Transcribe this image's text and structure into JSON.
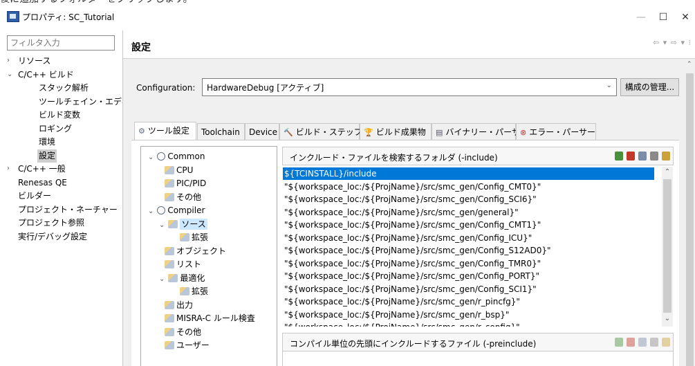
{
  "caption": "後に追加するフォルダーをクリックします。",
  "window": {
    "title": "プロパティ: SC_Tutorial",
    "controls": [
      "—",
      "☐",
      "✕"
    ]
  },
  "filter": {
    "placeholder": "フィルタ入力"
  },
  "nav": [
    {
      "label": "リソース",
      "expander": "›"
    },
    {
      "label": "C/C++ ビルド",
      "expander": "⌄"
    },
    {
      "label": "スタック解析"
    },
    {
      "label": "ツールチェイン・エディタ"
    },
    {
      "label": "ビルド変数"
    },
    {
      "label": "ロギング"
    },
    {
      "label": "環境"
    },
    {
      "label": "設定",
      "selected": true
    },
    {
      "label": "C/C++ 一般",
      "expander": "›"
    },
    {
      "label": "Renesas QE"
    },
    {
      "label": "ビルダー"
    },
    {
      "label": "プロジェクト・ネーチャー"
    },
    {
      "label": "プロジェクト参照"
    },
    {
      "label": "実行/デバッグ設定"
    }
  ],
  "header": {
    "title": "設定",
    "nav_glyphs": "⇦ ▾ ⇨ ▾ ⁝"
  },
  "config": {
    "label": "Configuration:",
    "value": "HardwareDebug [アクティブ]",
    "manage_button": "構成の管理..."
  },
  "tabs": [
    {
      "label": "ツール設定",
      "icon": "gear-icon",
      "active": true
    },
    {
      "label": "Toolchain"
    },
    {
      "label": "Device"
    },
    {
      "label": "ビルド・ステップ",
      "icon": "hammer-icon"
    },
    {
      "label": "ビルド成果物",
      "icon": "trophy-icon"
    },
    {
      "label": "バイナリー・パーサー",
      "icon": "binary-icon"
    },
    {
      "label": "エラー・パーサー",
      "icon": "error-icon"
    }
  ],
  "tree": [
    {
      "label": "Common",
      "expander": "⌄",
      "icon": "gear-icon"
    },
    {
      "label": "CPU",
      "icon": "tool-icon"
    },
    {
      "label": "PIC/PID",
      "icon": "tool-icon"
    },
    {
      "label": "その他",
      "icon": "tool-icon"
    },
    {
      "label": "Compiler",
      "expander": "⌄",
      "icon": "gear-icon"
    },
    {
      "label": "ソース",
      "expander": "⌄",
      "icon": "tool-icon",
      "selected": true
    },
    {
      "label": "拡張",
      "icon": "tool-icon"
    },
    {
      "label": "オブジェクト",
      "icon": "tool-icon"
    },
    {
      "label": "リスト",
      "icon": "tool-icon"
    },
    {
      "label": "最適化",
      "expander": "⌄",
      "icon": "tool-icon"
    },
    {
      "label": "拡張",
      "icon": "tool-icon"
    },
    {
      "label": "出力",
      "icon": "tool-icon"
    },
    {
      "label": "MISRA-C ルール検査",
      "icon": "tool-icon"
    },
    {
      "label": "その他",
      "icon": "tool-icon"
    },
    {
      "label": "ユーザー",
      "icon": "tool-icon"
    }
  ],
  "include_panel": {
    "title": "インクルード・ファイルを検索するフォルダ (-include)",
    "tool_icons": [
      "add-icon",
      "delete-icon",
      "edit-icon",
      "move-up-icon",
      "move-down-icon"
    ],
    "items": [
      "${TCINSTALL}/include",
      "\"${workspace_loc:/${ProjName}/src/smc_gen/Config_CMT0}\"",
      "\"${workspace_loc:/${ProjName}/src/smc_gen/Config_SCI6}\"",
      "\"${workspace_loc:/${ProjName}/src/smc_gen/general}\"",
      "\"${workspace_loc:/${ProjName}/src/smc_gen/Config_CMT1}\"",
      "\"${workspace_loc:/${ProjName}/src/smc_gen/Config_ICU}\"",
      "\"${workspace_loc:/${ProjName}/src/smc_gen/Config_S12AD0}\"",
      "\"${workspace_loc:/${ProjName}/src/smc_gen/Config_TMR0}\"",
      "\"${workspace_loc:/${ProjName}/src/smc_gen/Config_PORT}\"",
      "\"${workspace_loc:/${ProjName}/src/smc_gen/Config_SCI1}\"",
      "\"${workspace_loc:/${ProjName}/src/smc_gen/r_pincfg}\"",
      "\"${workspace_loc:/${ProjName}/src/smc_gen/r_bsp}\"",
      "\"${workspace_loc:/${ProjName}/src/smc_gen/r_config}\""
    ]
  },
  "preinclude_panel": {
    "title": "コンパイル単位の先頭にインクルードするファイル (-preinclude)",
    "tool_icons": [
      "add-icon",
      "delete-icon",
      "edit-icon",
      "move-up-icon",
      "move-down-icon"
    ]
  },
  "colors": {
    "selection": "#0078d7",
    "tree_selection": "#cce8ff",
    "nav_selection": "#cfcfcf",
    "content_bg": "#f0f0f0"
  }
}
